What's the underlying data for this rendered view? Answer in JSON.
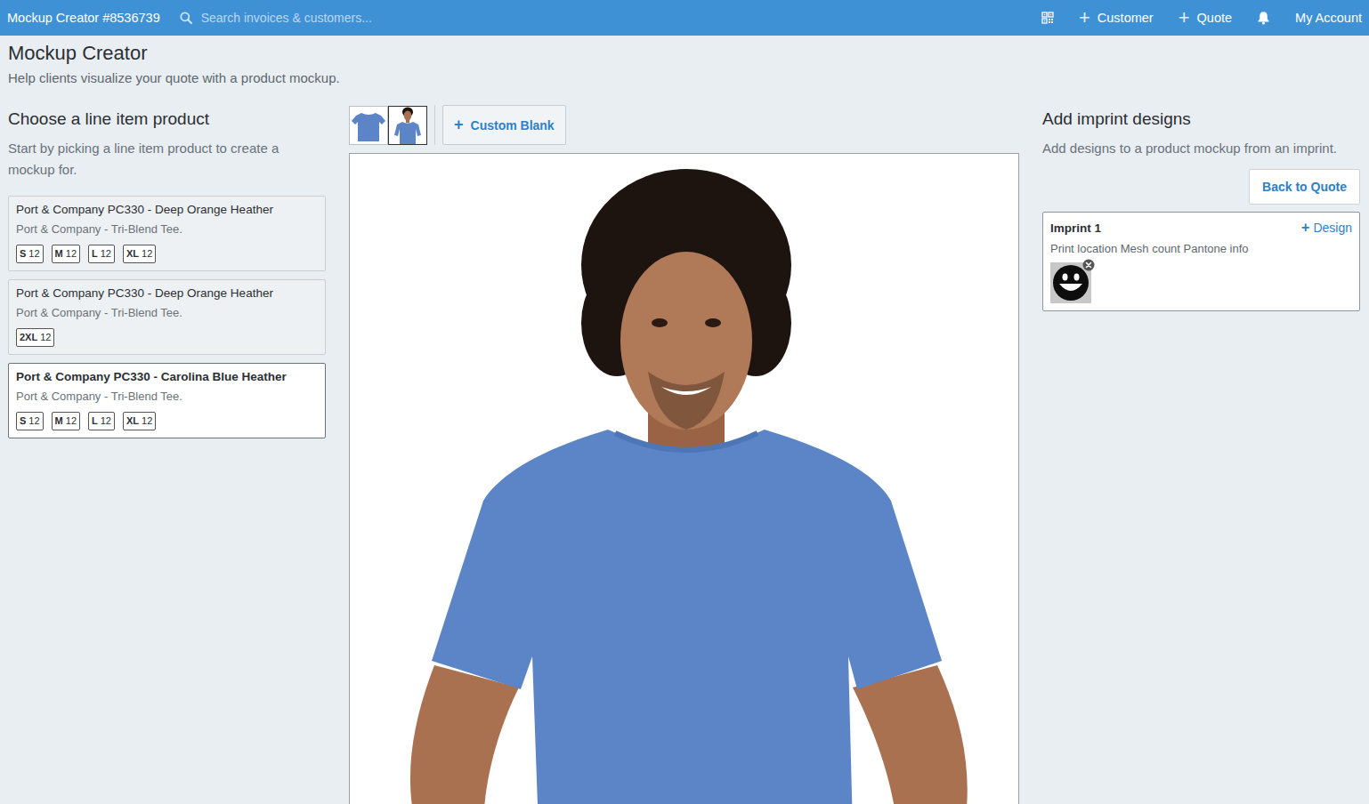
{
  "header": {
    "title": "Mockup Creator #8536739",
    "search": {
      "placeholder": "Search invoices & customers..."
    },
    "actions": [
      {
        "icon": "+",
        "label": "Customer"
      },
      {
        "icon": "+",
        "label": "Quote"
      }
    ],
    "account": "My Account"
  },
  "page": {
    "title": "Mockup Creator",
    "subtitle": "Help clients visualize your quote with a product mockup."
  },
  "products": {
    "title": "Choose a line item product",
    "description": "Start by picking a line item product to create a mockup for.",
    "items": [
      {
        "name": "Port & Company PC330 - Deep Orange Heather",
        "description": "Port & Company - Tri-Blend Tee.",
        "selected": false,
        "sizes": [
          {
            "size": "S",
            "qty": "12"
          },
          {
            "size": "M",
            "qty": "12"
          },
          {
            "size": "L",
            "qty": "12"
          },
          {
            "size": "XL",
            "qty": "12"
          }
        ]
      },
      {
        "name": "Port & Company PC330 - Deep Orange Heather",
        "description": "Port & Company - Tri-Blend Tee.",
        "selected": false,
        "sizes": [
          {
            "size": "2XL",
            "qty": "12"
          }
        ]
      },
      {
        "name": "Port & Company PC330 - Carolina Blue Heather",
        "description": "Port & Company - Tri-Blend Tee.",
        "selected": true,
        "sizes": [
          {
            "size": "S",
            "qty": "12"
          },
          {
            "size": "M",
            "qty": "12"
          },
          {
            "size": "L",
            "qty": "12"
          },
          {
            "size": "XL",
            "qty": "12"
          }
        ]
      }
    ]
  },
  "views": [
    {
      "kind": "flat",
      "selected": false
    },
    {
      "kind": "model",
      "selected": true
    }
  ],
  "custom_blank": {
    "icon": "+",
    "label": "Custom Blank"
  },
  "imprints": {
    "title": "Add imprint designs",
    "description": "Add designs to a product mockup from an imprint.",
    "back_button": "Back to Quote",
    "items": [
      {
        "name": "Imprint 1",
        "add_design": {
          "icon": "+",
          "label": "Design"
        },
        "details": "Print location Mesh count Pantone info"
      }
    ]
  }
}
